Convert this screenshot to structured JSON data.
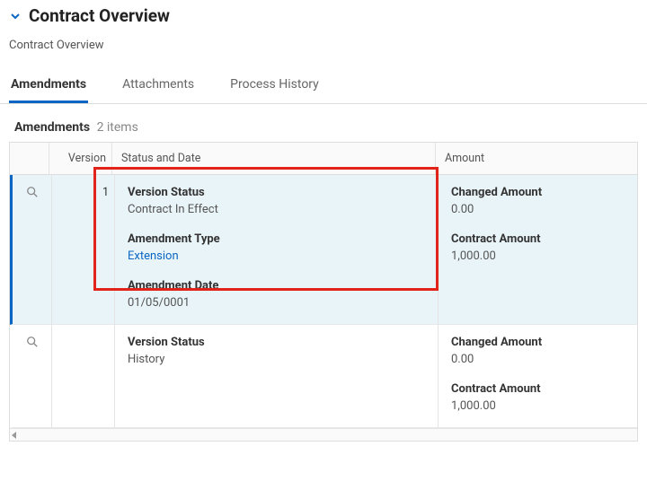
{
  "section": {
    "title": "Contract Overview"
  },
  "breadcrumb": "Contract Overview",
  "tabs": {
    "amendments": "Amendments",
    "attachments": "Attachments",
    "process_history": "Process History"
  },
  "amendments": {
    "label": "Amendments",
    "count_text": "2 items",
    "columns": {
      "version": "Version",
      "status_and_date": "Status and Date",
      "amount": "Amount"
    },
    "labels": {
      "version_status": "Version Status",
      "amendment_type": "Amendment Type",
      "amendment_date": "Amendment Date",
      "changed_amount": "Changed Amount",
      "contract_amount": "Contract Amount"
    },
    "rows": [
      {
        "version": "1",
        "version_status": "Contract In Effect",
        "amendment_type": "Extension",
        "amendment_date": "01/05/0001",
        "changed_amount": "0.00",
        "contract_amount": "1,000.00"
      },
      {
        "version": "",
        "version_status": "History",
        "amendment_type": "",
        "amendment_date": "",
        "changed_amount": "0.00",
        "contract_amount": "1,000.00"
      }
    ]
  }
}
